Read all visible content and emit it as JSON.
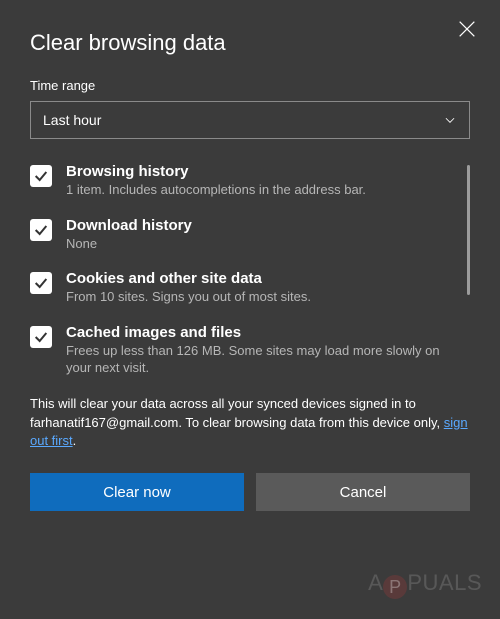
{
  "dialog": {
    "title": "Clear browsing data",
    "close_icon": "close"
  },
  "time_range": {
    "label": "Time range",
    "selected": "Last hour"
  },
  "options": [
    {
      "checked": true,
      "title": "Browsing history",
      "desc": "1 item. Includes autocompletions in the address bar."
    },
    {
      "checked": true,
      "title": "Download history",
      "desc": "None"
    },
    {
      "checked": true,
      "title": "Cookies and other site data",
      "desc": "From 10 sites. Signs you out of most sites."
    },
    {
      "checked": true,
      "title": "Cached images and files",
      "desc": "Frees up less than 126 MB. Some sites may load more slowly on your next visit."
    }
  ],
  "notice": {
    "part1": "This will clear your data across all your synced devices signed in to farhanatif167@gmail.com. To clear browsing data from this device only, ",
    "link": "sign out first",
    "part2": "."
  },
  "buttons": {
    "primary": "Clear now",
    "secondary": "Cancel"
  },
  "watermark": {
    "pre": "A",
    "dot": "P",
    "post": "PUALS"
  }
}
